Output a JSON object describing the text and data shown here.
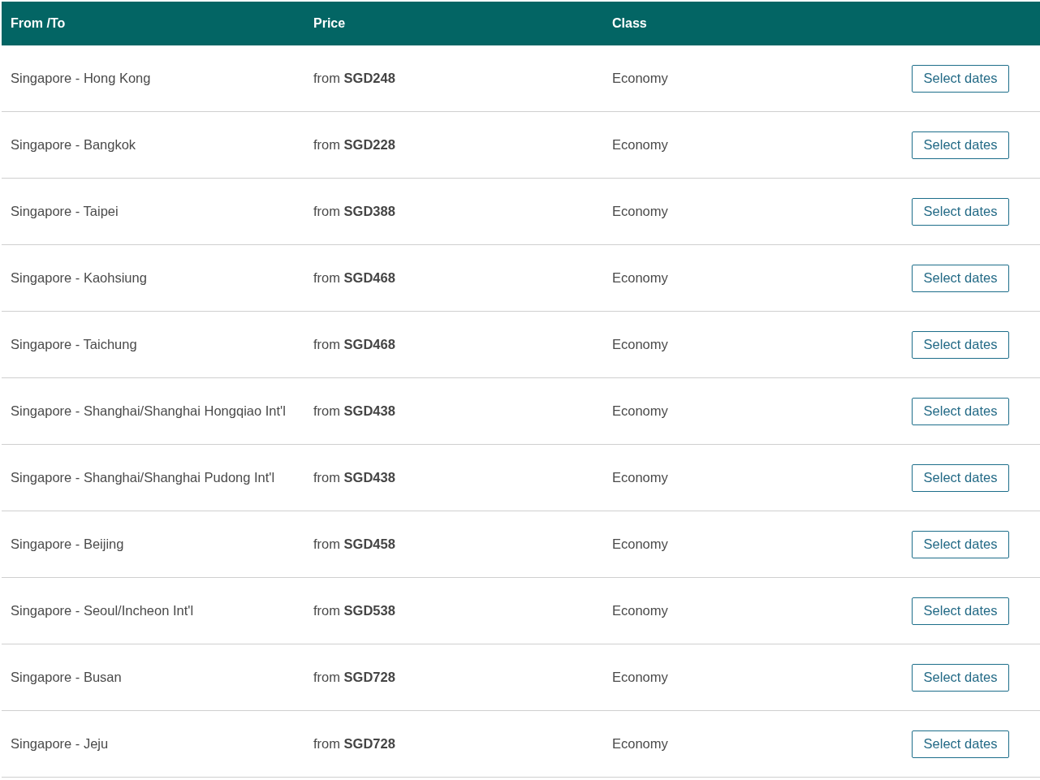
{
  "table": {
    "columns": [
      "From /To",
      "Price",
      "Class"
    ],
    "rows": [
      {
        "route": "Singapore - Hong Kong",
        "price": "from **SGD248**",
        "class": "Economy",
        "action": "Select dates"
      },
      {
        "route": "Singapore - Bangkok",
        "price": "from **SGD228**",
        "class": "Economy",
        "action": "Select dates"
      },
      {
        "route": "Singapore - Taipei",
        "price": "from **SGD388**",
        "class": "Economy",
        "action": "Select dates"
      },
      {
        "route": "Singapore - Kaohsiung",
        "price": "from **SGD468**",
        "class": "Economy",
        "action": "Select dates"
      },
      {
        "route": "Singapore - Taichung",
        "price": "from **SGD468**",
        "class": "Economy",
        "action": "Select dates"
      },
      {
        "route": "Singapore - Shanghai/Shanghai Hongqiao Int'l",
        "price": "from **SGD438**",
        "class": "Economy",
        "action": "Select dates"
      },
      {
        "route": "Singapore - Shanghai/Shanghai Pudong Int'l",
        "price": "from **SGD438**",
        "class": "Economy",
        "action": "Select dates"
      },
      {
        "route": "Singapore - Beijing",
        "price": "from **SGD458**",
        "class": "Economy",
        "action": "Select dates"
      },
      {
        "route": "Singapore - Seoul/Incheon Int'l",
        "price": "from **SGD538**",
        "class": "Economy",
        "action": "Select dates"
      },
      {
        "route": "Singapore - Busan",
        "price": "from **SGD728**",
        "class": "Economy",
        "action": "Select dates"
      },
      {
        "route": "Singapore - Jeju",
        "price": "from **SGD728**",
        "class": "Economy",
        "action": "Select dates"
      }
    ]
  }
}
